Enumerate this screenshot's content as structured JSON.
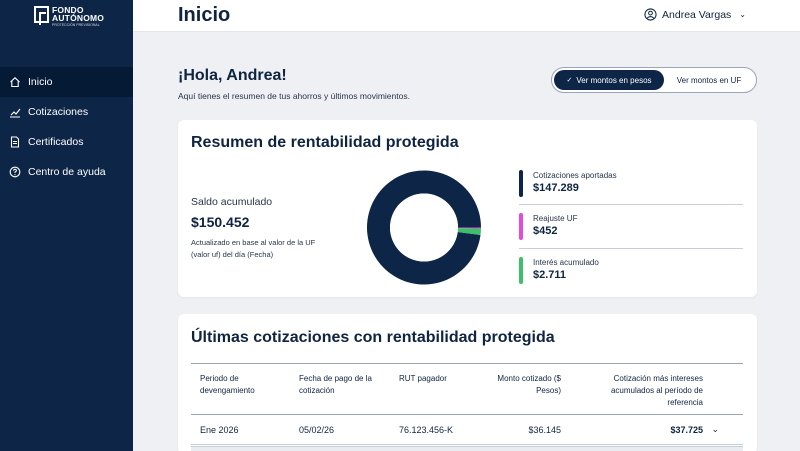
{
  "brand": {
    "name_line1": "FONDO",
    "name_line2": "AUTÓNOMO",
    "tagline": "PROTECCIÓN PREVISIONAL"
  },
  "sidebar": {
    "items": [
      {
        "label": "Inicio",
        "icon": "home-icon",
        "active": true
      },
      {
        "label": "Cotizaciones",
        "icon": "chart-icon",
        "active": false
      },
      {
        "label": "Certificados",
        "icon": "document-icon",
        "active": false
      },
      {
        "label": "Centro de ayuda",
        "icon": "help-icon",
        "active": false
      }
    ]
  },
  "header": {
    "title": "Inicio",
    "user_name": "Andrea Vargas"
  },
  "greeting": {
    "title": "¡Hola, Andrea!",
    "subtitle": "Aquí tienes el resumen de tus ahorros y últimos movimientos."
  },
  "toggle": {
    "option_pesos": "Ver montos en pesos",
    "option_uf": "Ver montos en UF",
    "selected": "pesos"
  },
  "summary": {
    "title": "Resumen de rentabilidad protegida",
    "saldo_label": "Saldo acumulado",
    "saldo_value": "$150.452",
    "saldo_note": "Actualizado en base al valor de la UF (valor uf) del día (Fecha)",
    "items": [
      {
        "label": "Cotizaciones aportadas",
        "value": "$147.289",
        "color": "#0d2546"
      },
      {
        "label": "Reajuste UF",
        "value": "$452",
        "color": "#e64ad8"
      },
      {
        "label": "Interés acumulado",
        "value": "$2.711",
        "color": "#3cbf6a"
      }
    ]
  },
  "chart_data": {
    "type": "pie",
    "categories": [
      "Cotizaciones aportadas",
      "Reajuste UF",
      "Interés acumulado"
    ],
    "values": [
      147289,
      452,
      2711
    ],
    "colors": [
      "#0d2546",
      "#e64ad8",
      "#3cbf6a"
    ]
  },
  "table": {
    "title": "Últimas cotizaciones con rentabilidad protegida",
    "headers": {
      "periodo": "Periodo de devengamiento",
      "fecha": "Fecha de pago de la cotización",
      "rut": "RUT pagador",
      "monto": "Monto cotizado ($ Pesos)",
      "total": "Cotización más intereses acumulados al período de referencia"
    },
    "rows": [
      {
        "periodo": "Ene 2026",
        "fecha": "05/02/26",
        "rut": "76.123.456-K",
        "monto": "$36.145",
        "total": "$37.725"
      }
    ]
  },
  "icons": {
    "chevron": "chevron-down-icon",
    "user": "user-icon",
    "check": "check-icon"
  }
}
